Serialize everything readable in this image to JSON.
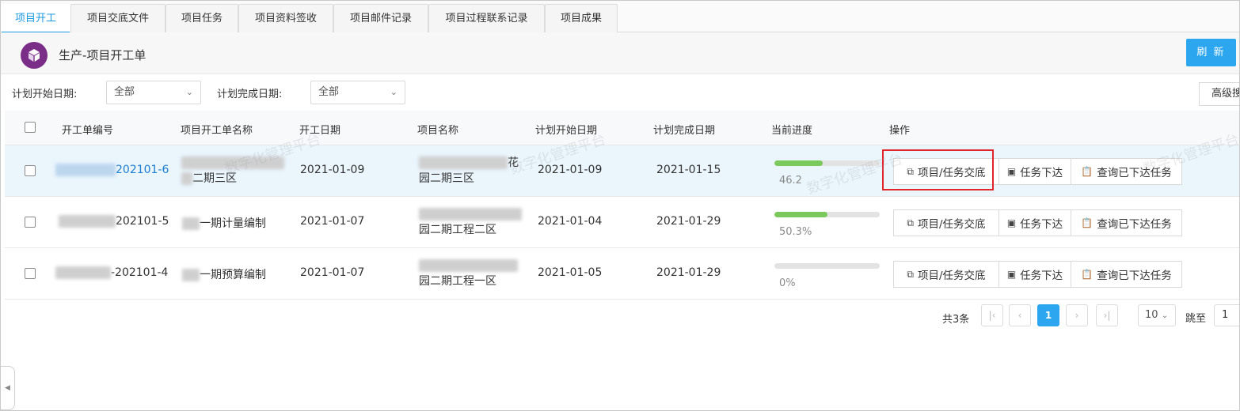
{
  "tabs": [
    {
      "label": "项目开工",
      "active": true
    },
    {
      "label": "项目交底文件"
    },
    {
      "label": "项目任务"
    },
    {
      "label": "项目资料签收"
    },
    {
      "label": "项目邮件记录"
    },
    {
      "label": "项目过程联系记录"
    },
    {
      "label": "项目成果"
    }
  ],
  "header": {
    "title": "生产-项目开工单",
    "logo_icon": "cube-icon",
    "refresh_label": "刷 新",
    "accent_color": "#2ba6ef",
    "logo_color": "#7a2e88"
  },
  "filters": {
    "start_label": "计划开始日期:",
    "start_value": "全部",
    "end_label": "计划完成日期:",
    "end_value": "全部",
    "advanced_label": "高级搜"
  },
  "table": {
    "columns": [
      "开工单编号",
      "项目开工单名称",
      "开工日期",
      "项目名称",
      "计划开始日期",
      "计划完成日期",
      "当前进度",
      "操作"
    ],
    "rows": [
      {
        "code": "202101-6",
        "name": "二期三区",
        "start_date": "2021-01-09",
        "project_name_suffix": "花",
        "project_name_line2": "园二期三区",
        "plan_start": "2021-01-09",
        "plan_end": "2021-01-15",
        "progress": 46.2,
        "progress_text": "46.2",
        "selected": true
      },
      {
        "code": "202101-5",
        "name": "一期计量编制",
        "start_date": "2021-01-07",
        "project_name_suffix": "",
        "project_name_line2": "园二期工程二区",
        "plan_start": "2021-01-04",
        "plan_end": "2021-01-29",
        "progress": 50.3,
        "progress_text": "50.3%",
        "selected": false
      },
      {
        "code": "-202101-4",
        "name": "一期预算编制",
        "start_date": "2021-01-07",
        "project_name_suffix": "",
        "project_name_line2": "园二期工程一区",
        "plan_start": "2021-01-05",
        "plan_end": "2021-01-29",
        "progress": 0,
        "progress_text": "0%",
        "selected": false
      }
    ],
    "actions": {
      "handover": "项目/任务交底",
      "assign": "任务下达",
      "query": "查询已下达任务"
    }
  },
  "pagination": {
    "total": "共3条",
    "current_page": "1",
    "page_size": "10",
    "jump_label": "跳至",
    "jump_value": "1"
  },
  "watermark": "数字化管理平台"
}
